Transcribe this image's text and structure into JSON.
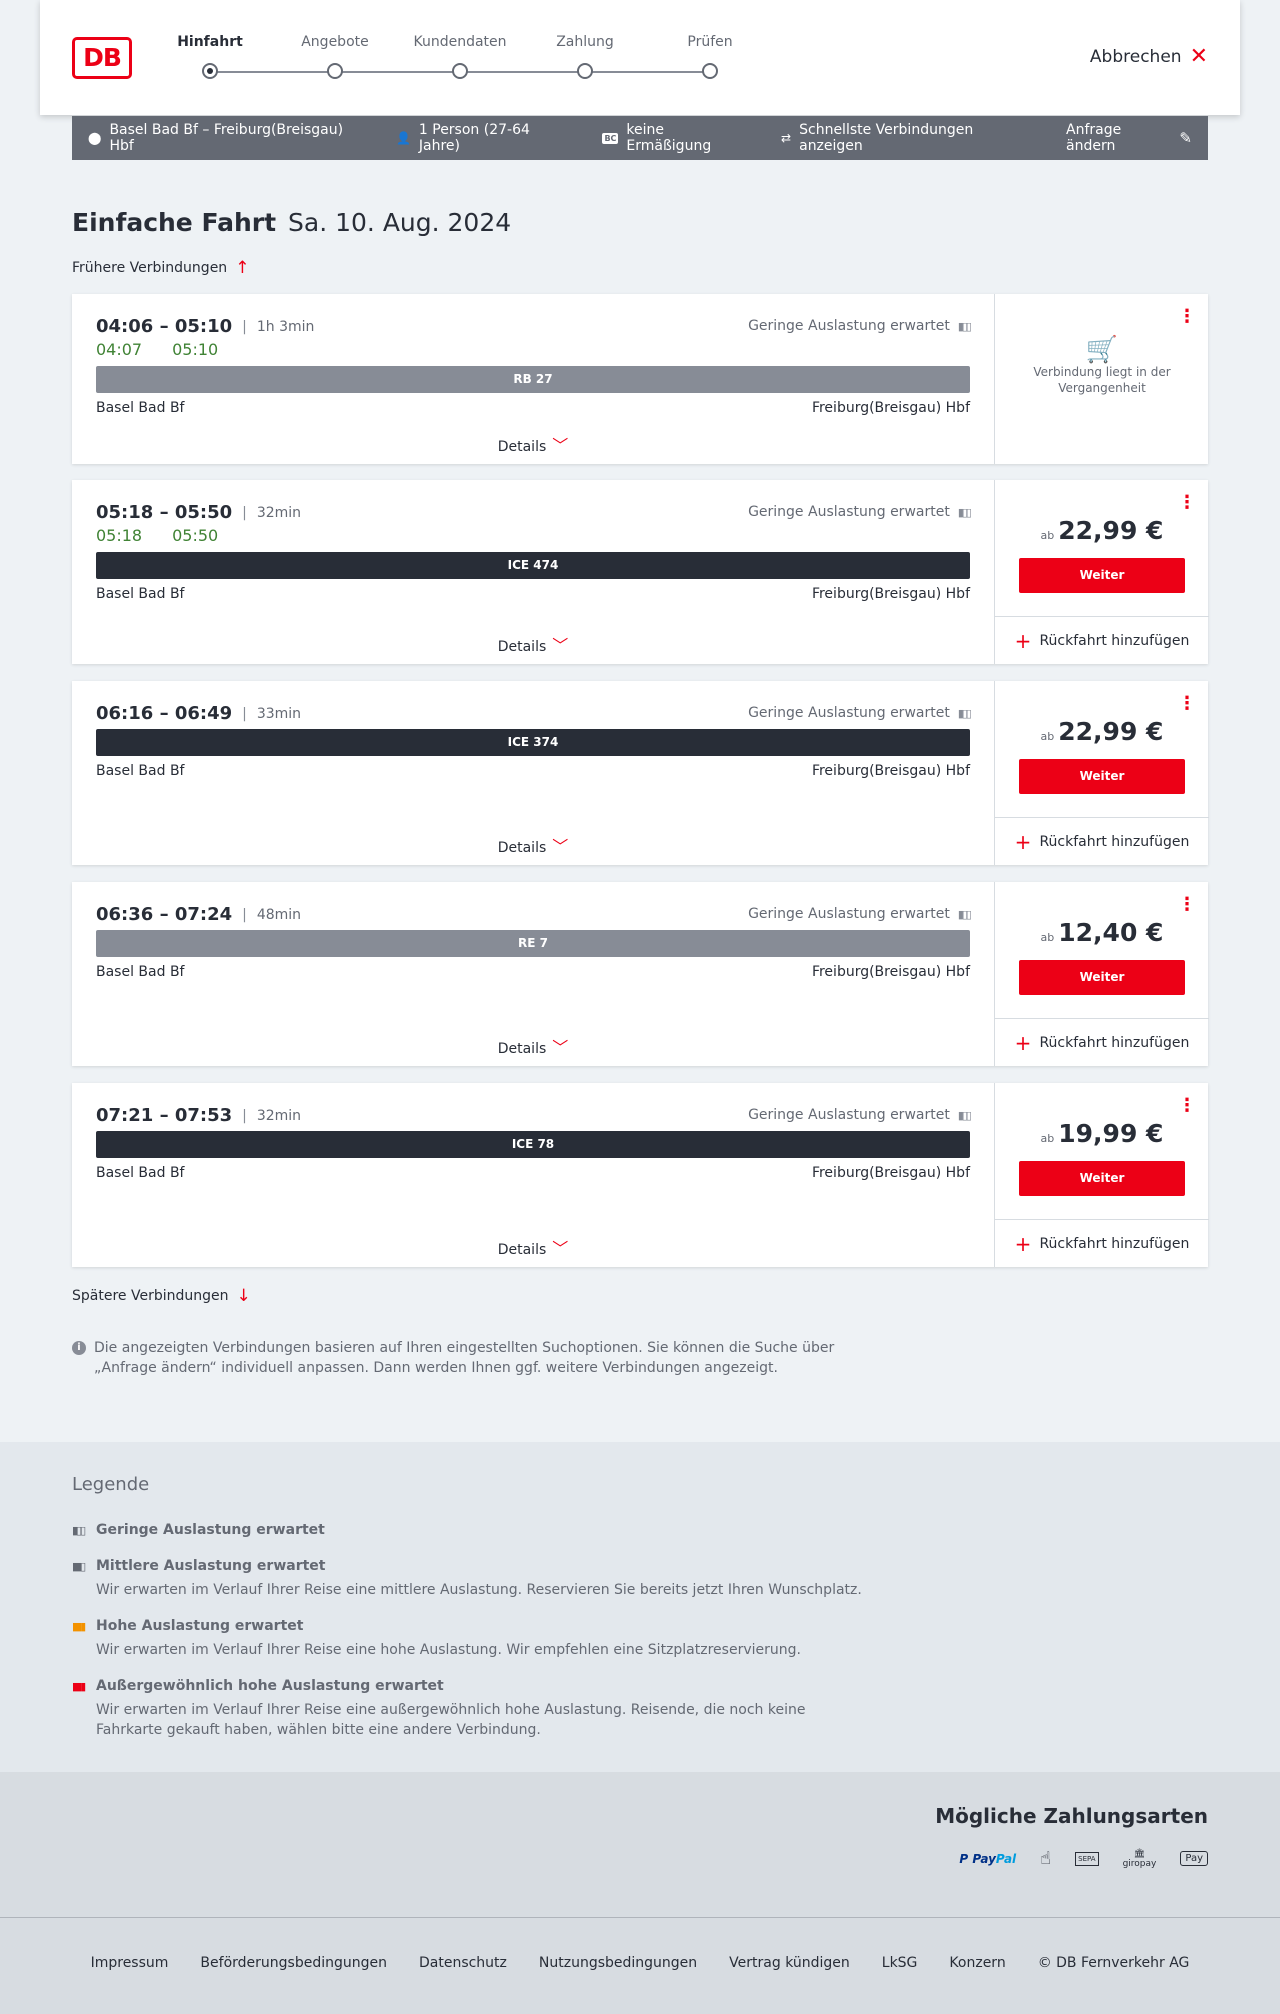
{
  "header": {
    "logo": "DB",
    "steps": [
      {
        "label": "Hinfahrt",
        "active": true
      },
      {
        "label": "Angebote",
        "active": false
      },
      {
        "label": "Kundendaten",
        "active": false
      },
      {
        "label": "Zahlung",
        "active": false
      },
      {
        "label": "Prüfen",
        "active": false
      }
    ],
    "cancel_label": "Abbrechen"
  },
  "summary": {
    "route": "Basel Bad Bf – Freiburg(Breisgau) Hbf",
    "passengers": "1 Person (27-64 Jahre)",
    "discount_badge": "BC",
    "discount": "keine Ermäßigung",
    "option": "Schnellste Verbindungen anzeigen",
    "edit_label": "Anfrage ändern"
  },
  "page": {
    "title": "Einfache Fahrt",
    "date": "Sa. 10. Aug. 2024",
    "earlier_label": "Frühere Verbindungen",
    "later_label": "Spätere Verbindungen",
    "info_text": "Die angezeigten Verbindungen basieren auf Ihren eingestellten Suchoptionen. Sie können die Suche über „Anfrage ändern“ individuell anpassen. Dann werden Ihnen ggf. weitere Verbindungen angezeigt."
  },
  "connections": [
    {
      "times": "04:06 – 05:10",
      "duration": "1h 3min",
      "realtime_dep": "04:07",
      "realtime_arr": "05:10",
      "load": "Geringe Auslastung erwartet",
      "train": "RB 27",
      "train_type": "regional",
      "from": "Basel Bad Bf",
      "to": "Freiburg(Breisgau) Hbf",
      "details_label": "Details",
      "past": true,
      "past_text": "Verbindung liegt in der Vergangenheit"
    },
    {
      "times": "05:18 – 05:50",
      "duration": "32min",
      "realtime_dep": "05:18",
      "realtime_arr": "05:50",
      "load": "Geringe Auslastung erwartet",
      "train": "ICE 474",
      "train_type": "ice",
      "from": "Basel Bad Bf",
      "to": "Freiburg(Breisgau) Hbf",
      "details_label": "Details",
      "ab": "ab",
      "price": "22,99 €",
      "button": "Weiter",
      "return_label": "Rückfahrt hinzufügen"
    },
    {
      "times": "06:16 – 06:49",
      "duration": "33min",
      "load": "Geringe Auslastung erwartet",
      "train": "ICE 374",
      "train_type": "ice",
      "from": "Basel Bad Bf",
      "to": "Freiburg(Breisgau) Hbf",
      "details_label": "Details",
      "ab": "ab",
      "price": "22,99 €",
      "button": "Weiter",
      "return_label": "Rückfahrt hinzufügen"
    },
    {
      "times": "06:36 – 07:24",
      "duration": "48min",
      "load": "Geringe Auslastung erwartet",
      "train": "RE 7",
      "train_type": "regional",
      "from": "Basel Bad Bf",
      "to": "Freiburg(Breisgau) Hbf",
      "details_label": "Details",
      "ab": "ab",
      "price": "12,40 €",
      "button": "Weiter",
      "return_label": "Rückfahrt hinzufügen"
    },
    {
      "times": "07:21 – 07:53",
      "duration": "32min",
      "load": "Geringe Auslastung erwartet",
      "train": "ICE 78",
      "train_type": "ice",
      "from": "Basel Bad Bf",
      "to": "Freiburg(Breisgau) Hbf",
      "details_label": "Details",
      "ab": "ab",
      "price": "19,99 €",
      "button": "Weiter",
      "return_label": "Rückfahrt hinzufügen"
    }
  ],
  "legend": {
    "title": "Legende",
    "items": [
      {
        "label": "Geringe Auslastung erwartet",
        "desc": "",
        "color": "#646973"
      },
      {
        "label": "Mittlere Auslastung erwartet",
        "desc": "Wir erwarten im Verlauf Ihrer Reise eine mittlere Auslastung. Reservieren Sie bereits jetzt Ihren Wunschplatz.",
        "color": "#646973"
      },
      {
        "label": "Hohe Auslastung erwartet",
        "desc": "Wir erwarten im Verlauf Ihrer Reise eine hohe Auslastung. Wir empfehlen eine Sitzplatzreservierung.",
        "color": "#f39200"
      },
      {
        "label": "Außergewöhnlich hohe Auslastung erwartet",
        "desc": "Wir erwarten im Verlauf Ihrer Reise eine außergewöhnlich hohe Auslastung. Reisende, die noch keine Fahrkarte gekauft haben, wählen bitte eine andere Verbindung.",
        "color": "#ec0016"
      }
    ]
  },
  "payment": {
    "title": "Mögliche Zahlungsarten",
    "methods": [
      "PayPal",
      "Kreditkarte",
      "SEPA",
      "giropay",
      "Apple Pay"
    ],
    "paypal_a": "Pay",
    "paypal_b": "Pal",
    "giropay": "giropay",
    "applepay": "Pay",
    "sepa": "SEPA"
  },
  "footer": {
    "links": [
      "Impressum",
      "Beförderungsbedingungen",
      "Datenschutz",
      "Nutzungsbedingungen",
      "Vertrag kündigen",
      "LkSG",
      "Konzern",
      "© DB Fernverkehr AG"
    ]
  },
  "colors": {
    "accent": "#ec0016",
    "realtime": "#408335",
    "bar_dark": "#282d37",
    "bar_regional": "#878c96"
  }
}
